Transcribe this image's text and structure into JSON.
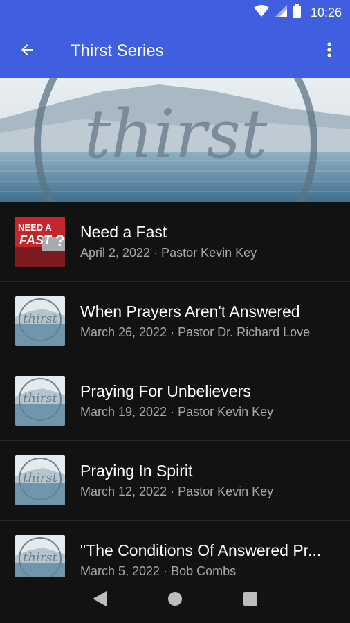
{
  "status_bar": {
    "time": "10:26",
    "icons": [
      "wifi-icon",
      "cell-signal-icon",
      "battery-icon"
    ]
  },
  "app_bar": {
    "title": "Thirst Series",
    "back_icon": "arrow-back-icon",
    "menu_icon": "more-vert-icon"
  },
  "hero": {
    "logo_text": "thirst"
  },
  "list": {
    "items": [
      {
        "title": "Need a Fast",
        "subtitle": "April 2, 2022 · Pastor Kevin Key",
        "thumb": "need-a-fast",
        "thumb_text": "NEED A FAST?"
      },
      {
        "title": "When Prayers Aren't Answered",
        "subtitle": "March 26, 2022 · Pastor Dr. Richard Love",
        "thumb": "thirst",
        "thumb_text": "thirst"
      },
      {
        "title": "Praying For Unbelievers",
        "subtitle": "March 19, 2022 · Pastor Kevin Key",
        "thumb": "thirst",
        "thumb_text": "thirst"
      },
      {
        "title": "Praying In Spirit",
        "subtitle": "March 12, 2022 · Pastor Kevin Key",
        "thumb": "thirst",
        "thumb_text": "thirst"
      },
      {
        "title": "\"The Conditions Of Answered Pr...",
        "subtitle": "March 5, 2022 · Bob Combs",
        "thumb": "thirst",
        "thumb_text": "thirst"
      }
    ]
  },
  "nav_bar": {
    "icons": [
      "back-triangle-icon",
      "home-circle-icon",
      "recents-square-icon"
    ]
  },
  "colors": {
    "primary": "#3f5fe0",
    "background": "#121212",
    "subtitle": "#a8a8a8"
  }
}
